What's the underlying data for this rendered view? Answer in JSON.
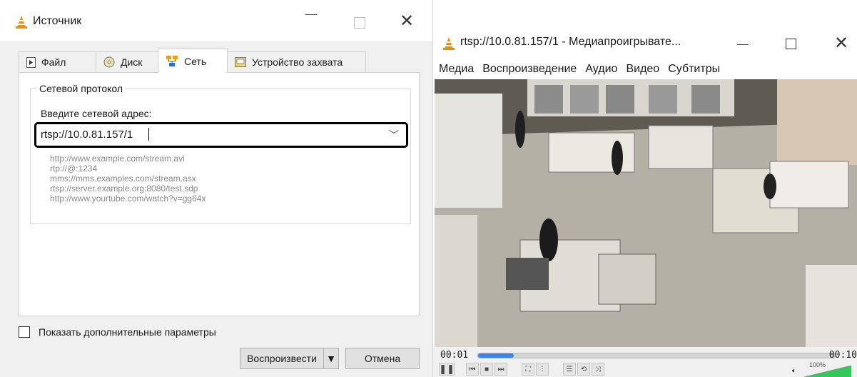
{
  "dialog": {
    "title": "Источник",
    "tabs": [
      {
        "label": "Файл",
        "icon": "file-play-icon"
      },
      {
        "label": "Диск",
        "icon": "disc-icon"
      },
      {
        "label": "Сеть",
        "icon": "network-icon",
        "active": true
      },
      {
        "label": "Устройство захвата",
        "icon": "capture-device-icon"
      }
    ],
    "group_title": "Сетевой протокол",
    "address_label": "Введите сетевой адрес:",
    "address_value": "rtsp://10.0.81.157/1",
    "hints": [
      "http://www.example.com/stream.avi",
      "rtp://@:1234",
      "mms://mms.examples.com/stream.asx",
      "rtsp://server.example.org:8080/test.sdp",
      "http://www.yourtube.com/watch?v=gg64x"
    ],
    "show_more_label": "Показать дополнительные параметры",
    "play_label": "Воспроизвести",
    "cancel_label": "Отмена"
  },
  "player": {
    "title": "rtsp://10.0.81.157/1 - Медиапроигрывате...",
    "menu": [
      "Медиа",
      "Воспроизведение",
      "Аудио",
      "Видео",
      "Субтитры"
    ],
    "time_elapsed": "00:01",
    "time_total": "00:10",
    "progress": 0.1,
    "volume_label": "100%",
    "volume": 1.0
  },
  "colors": {
    "vlc_orange": "#f08c00",
    "seek_fill": "#3b82f6",
    "volume_green": "#34c759"
  }
}
